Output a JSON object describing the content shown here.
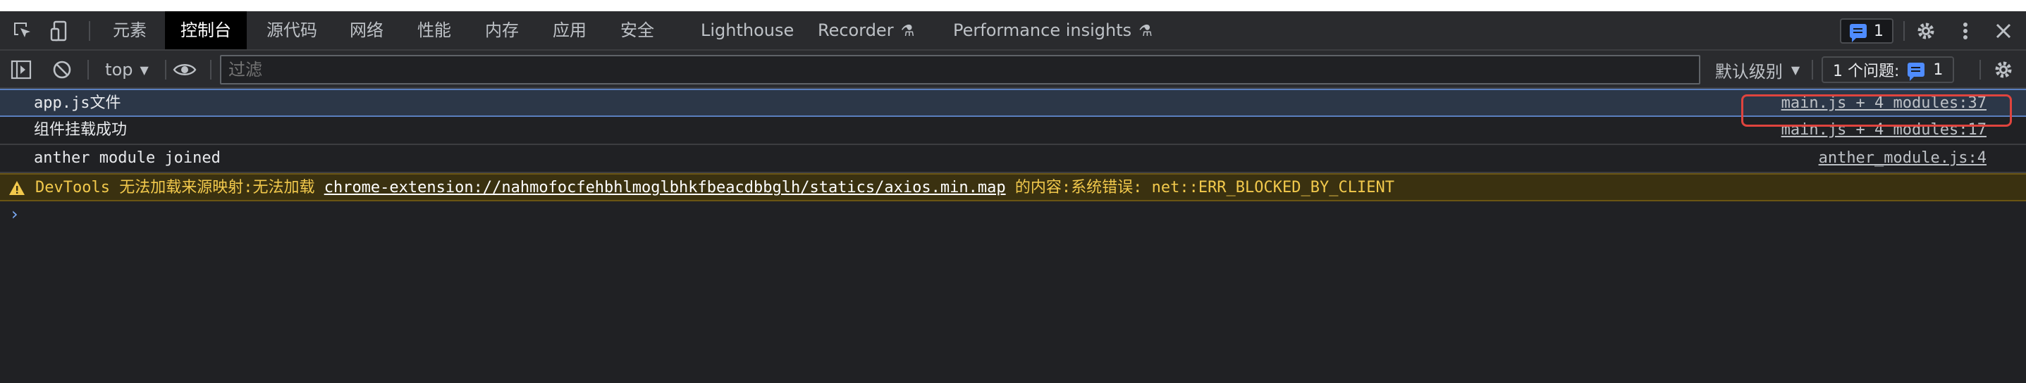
{
  "tabs": {
    "items": [
      {
        "label": "元素",
        "active": false
      },
      {
        "label": "控制台",
        "active": true
      },
      {
        "label": "源代码",
        "active": false
      },
      {
        "label": "网络",
        "active": false
      },
      {
        "label": "性能",
        "active": false
      },
      {
        "label": "内存",
        "active": false
      },
      {
        "label": "应用",
        "active": false
      },
      {
        "label": "安全",
        "active": false
      },
      {
        "label": "Lighthouse",
        "active": false
      },
      {
        "label": "Recorder",
        "active": false,
        "experimental": true
      },
      {
        "label": "Performance insights",
        "active": false,
        "experimental": true
      }
    ],
    "issues_badge_count": "1"
  },
  "toolbar": {
    "context_label": "top",
    "filter_placeholder": "过滤",
    "levels_label": "默认级别",
    "issues_label": "1 个问题:",
    "issues_count": "1"
  },
  "console": {
    "messages": [
      {
        "text": "app.js文件",
        "source": "main.js + 4 modules:37",
        "type": "log",
        "selected": true
      },
      {
        "text": "组件挂载成功",
        "source": "main.js + 4 modules:17",
        "type": "log",
        "selected": false
      },
      {
        "text": "anther module joined",
        "source": "anther_module.js:4",
        "type": "log",
        "selected": false
      }
    ],
    "warning": {
      "prefix": "DevTools 无法加载来源映射:无法加载",
      "url": "chrome-extension://nahmofocfehbhlmoglbhkfbeacdbbglh/statics/axios.min.map",
      "suffix": "的内容:系统错误: net::ERR_BLOCKED_BY_CLIENT"
    },
    "prompt_symbol": "›"
  },
  "colors": {
    "background": "#202124",
    "toolbar": "#2a2b2e",
    "warning_bg": "#3a3110",
    "warning_text": "#f2c94c",
    "accent_blue": "#4f8cff",
    "highlight_red": "#e0443e"
  },
  "icons": [
    "inspect-element-icon",
    "device-toggle-icon",
    "issues-message-icon",
    "settings-gear-icon",
    "more-vert-icon",
    "close-icon",
    "sidebar-toggle-icon",
    "clear-console-icon",
    "eye-icon",
    "warning-triangle-icon",
    "flask-icon"
  ]
}
